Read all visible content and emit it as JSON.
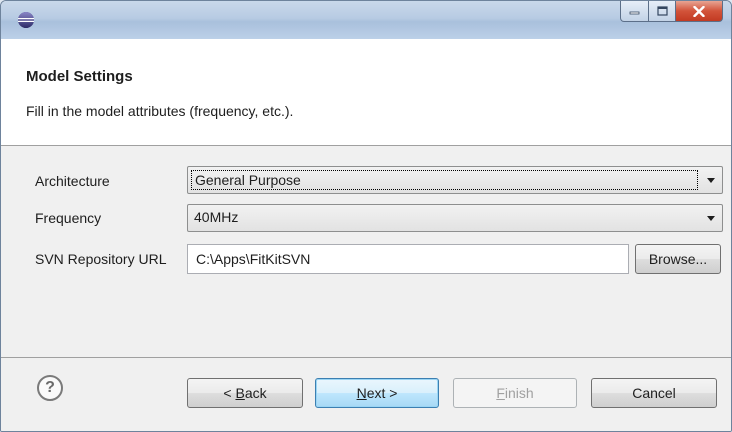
{
  "window": {
    "icon": "eclipse-icon",
    "controls": [
      "minimize-icon",
      "maximize-icon",
      "close-icon"
    ]
  },
  "header": {
    "title": "Model Settings",
    "description": "Fill in the model attributes (frequency, etc.)."
  },
  "form": {
    "architecture": {
      "label": "Architecture",
      "value": "General Purpose"
    },
    "frequency": {
      "label": "Frequency",
      "value": "40MHz"
    },
    "svn": {
      "label": "SVN Repository URL",
      "value": "C:\\Apps\\FitKitSVN",
      "browse_label": "Browse..."
    }
  },
  "footer": {
    "help_icon": "help-icon",
    "back_mnemonic": "B",
    "back_rest": "ack",
    "back_prefix": "< ",
    "next_mnemonic": "N",
    "next_rest": "ext >",
    "finish_mnemonic": "F",
    "finish_rest": "inish",
    "cancel_label": "Cancel"
  },
  "colors": {
    "titlebar": "#b7cbe3",
    "header_bg": "#ffffff",
    "body_bg": "#f0f0f0",
    "default_button": "#bee6fd",
    "close_button": "#d2533a"
  }
}
